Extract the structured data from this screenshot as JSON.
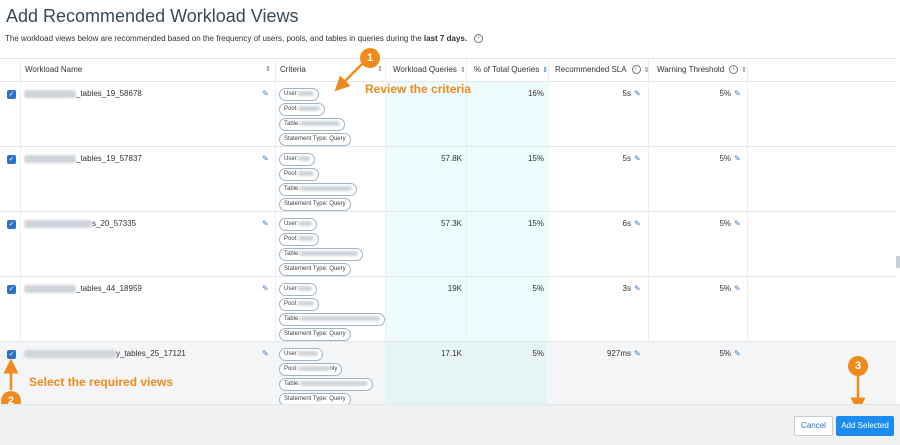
{
  "page": {
    "title": "Add Recommended Workload Views",
    "subtitle_text": "The workload views below are recommended based on the frequency of users, pools, and tables in queries during the",
    "subtitle_bold": "last 7 days."
  },
  "table": {
    "headers": {
      "workload_name": "Workload Name",
      "criteria": "Criteria",
      "workload_queries": "Workload Queries",
      "pct_total": "% of Total Queries",
      "recommended_sla": "Recommended SLA",
      "warning_threshold": "Warning Threshold"
    },
    "rows": [
      {
        "name_suffix": "_tables_19_58678",
        "chips": [
          "User:",
          "Pool:",
          "Table:",
          "Statement Type: Query"
        ],
        "queries": "",
        "pct": "16%",
        "sla": "5s",
        "threshold": "5%"
      },
      {
        "name_suffix": "_tables_19_57837",
        "chips": [
          "User:",
          "Pool:",
          "Table:",
          "Statement Type: Query"
        ],
        "queries": "57.8K",
        "pct": "15%",
        "sla": "5s",
        "threshold": "5%"
      },
      {
        "name_suffix": "s_20_57335",
        "chips": [
          "User:",
          "Pool:",
          "Table:",
          "Statement Type: Query"
        ],
        "queries": "57.3K",
        "pct": "15%",
        "sla": "6s",
        "threshold": "5%"
      },
      {
        "name_suffix": "_tables_44_18959",
        "chips": [
          "User:",
          "Pool:",
          "Table:",
          "Statement Type: Query"
        ],
        "queries": "19K",
        "pct": "5%",
        "sla": "3s",
        "threshold": "5%"
      },
      {
        "name_suffix": "y_tables_25_17121",
        "chips": [
          "User:",
          "Pool:",
          "nly",
          "Table:",
          "Statement Type: Query"
        ],
        "queries": "17.1K",
        "pct": "5%",
        "sla": "927ms",
        "threshold": "5%"
      }
    ]
  },
  "annotations": {
    "badge1": "1",
    "label1": "Review the criteria",
    "badge2": "2",
    "label2": "Select the required views",
    "badge3": "3"
  },
  "footer": {
    "cancel": "Cancel",
    "add_selected": "Add Selected"
  },
  "colors": {
    "accent": "#1d8cf0",
    "annotation": "#f08a1c",
    "highlight": "#ecfbfd"
  }
}
